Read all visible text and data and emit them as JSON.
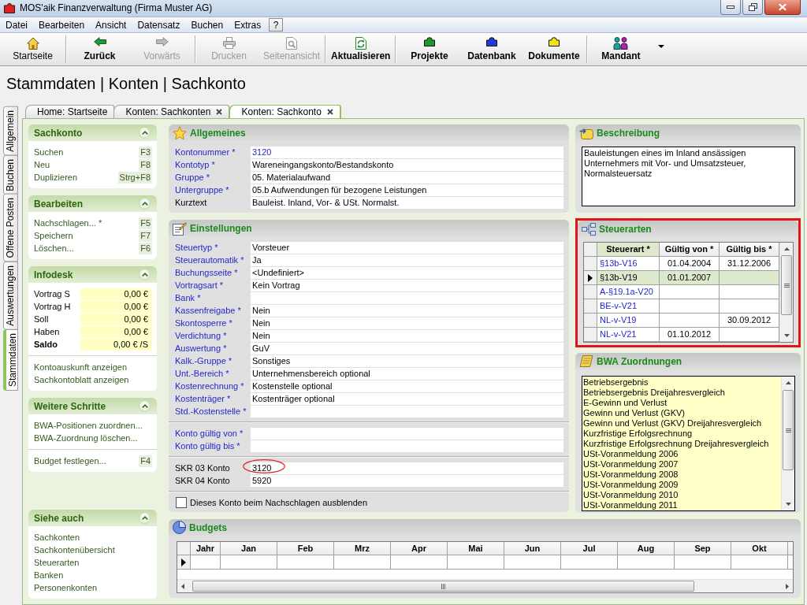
{
  "window": {
    "title": "MOS'aik Finanzverwaltung (Firma Muster AG)"
  },
  "menu": {
    "items": [
      "Datei",
      "Bearbeiten",
      "Ansicht",
      "Datensatz",
      "Buchen",
      "Extras"
    ],
    "help": "?"
  },
  "toolbar": [
    {
      "buttons": [
        {
          "label": "Startseite",
          "bold": false,
          "disabled": false
        }
      ]
    },
    {
      "buttons": [
        {
          "label": "Zurück",
          "bold": true,
          "disabled": false
        },
        {
          "label": "Vorwärts",
          "bold": false,
          "disabled": true
        }
      ]
    },
    {
      "buttons": [
        {
          "label": "Drucken",
          "bold": false,
          "disabled": true
        },
        {
          "label": "Seitenansicht",
          "bold": false,
          "disabled": true
        }
      ]
    },
    {
      "buttons": [
        {
          "label": "Aktualisieren",
          "bold": true,
          "disabled": false
        }
      ]
    },
    {
      "buttons": [
        {
          "label": "Projekte",
          "bold": true,
          "disabled": false
        },
        {
          "label": "Datenbank",
          "bold": true,
          "disabled": false
        },
        {
          "label": "Dokumente",
          "bold": true,
          "disabled": false
        }
      ]
    },
    {
      "buttons": [
        {
          "label": "Mandant",
          "bold": true,
          "disabled": false
        }
      ]
    }
  ],
  "breadcrumb": "Stammdaten | Konten | Sachkonto",
  "vertical_tabs": [
    {
      "label": "Allgemein",
      "selected": false
    },
    {
      "label": "Buchen",
      "selected": false
    },
    {
      "label": "Offene Posten",
      "selected": false
    },
    {
      "label": "Auswertungen",
      "selected": false
    },
    {
      "label": "Stammdaten",
      "selected": true
    }
  ],
  "doc_tabs": [
    {
      "label": "Home: Startseite",
      "selected": false,
      "closable": false
    },
    {
      "label": "Konten: Sachkonten",
      "selected": false,
      "closable": true
    },
    {
      "label": "Konten: Sachkonto",
      "selected": true,
      "closable": true
    }
  ],
  "task_pane": [
    {
      "title": "Sachkonto",
      "expanded": true,
      "sections": [
        {
          "kind": "links",
          "items": [
            {
              "label": "Suchen",
              "shortcut": "F3"
            },
            {
              "label": "Neu",
              "shortcut": "F8"
            },
            {
              "label": "Duplizieren",
              "shortcut": "Strg+F8"
            }
          ]
        }
      ]
    },
    {
      "title": "Bearbeiten",
      "expanded": true,
      "sections": [
        {
          "kind": "links",
          "items": [
            {
              "label": "Nachschlagen... *",
              "shortcut": "F5"
            },
            {
              "label": "Speichern",
              "shortcut": "F7"
            },
            {
              "label": "Löschen...",
              "shortcut": "F6"
            }
          ]
        }
      ]
    },
    {
      "title": "Infodesk",
      "expanded": true,
      "sections": [
        {
          "kind": "values",
          "items": [
            {
              "label": "Vortrag S",
              "value": "0,00 €",
              "bold": false
            },
            {
              "label": "Vortrag H",
              "value": "0,00 €",
              "bold": false
            },
            {
              "label": "Soll",
              "value": "0,00 €",
              "bold": false
            },
            {
              "label": "Haben",
              "value": "0,00 €",
              "bold": false
            },
            {
              "label": "Saldo",
              "value": "0,00 € /S",
              "bold": true
            }
          ]
        },
        {
          "kind": "links",
          "items": [
            {
              "label": "Kontoauskunft anzeigen"
            },
            {
              "label": "Sachkontoblatt anzeigen"
            }
          ]
        }
      ]
    },
    {
      "title": "Weitere Schritte",
      "expanded": true,
      "sections": [
        {
          "kind": "links",
          "items": [
            {
              "label": "BWA-Positionen zuordnen..."
            },
            {
              "label": "BWA-Zuordnung löschen..."
            }
          ]
        },
        {
          "kind": "links",
          "items": [
            {
              "label": "Budget festlegen...",
              "shortcut": "F4"
            }
          ]
        }
      ]
    },
    {
      "title": "Siehe auch",
      "expanded": true,
      "sections": [
        {
          "kind": "links",
          "items": [
            {
              "label": "Sachkonten"
            },
            {
              "label": "Sachkontenübersicht"
            },
            {
              "label": "Steuerarten"
            },
            {
              "label": "Banken"
            },
            {
              "label": "Personenkonten"
            }
          ]
        }
      ]
    }
  ],
  "general": {
    "title": "Allgemeines",
    "fields": [
      {
        "label": "Kontonummer *",
        "value": "3120",
        "link": true,
        "value_link": true
      },
      {
        "label": "Kontotyp *",
        "value": "Wareneingangskonto/Bestandskonto",
        "link": true,
        "value_link": false
      },
      {
        "label": "Gruppe *",
        "value": "05. Materialaufwand",
        "link": true,
        "value_link": false
      },
      {
        "label": "Untergruppe *",
        "value": "05.b Aufwendungen für bezogene Leistungen",
        "link": true,
        "value_link": false
      },
      {
        "label": "Kurztext",
        "value": "Bauleist. Inland, Vor- & USt. Normalst.",
        "link": false,
        "value_link": false
      }
    ]
  },
  "settings": {
    "title": "Einstellungen",
    "groups": [
      {
        "fields": [
          {
            "label": "Steuertyp *",
            "value": "Vorsteuer",
            "link": true
          },
          {
            "label": "Steuerautomatik *",
            "value": "Ja",
            "link": true
          },
          {
            "label": "Buchungsseite *",
            "value": "<Undefiniert>",
            "link": true
          },
          {
            "label": "Vortragsart *",
            "value": "Kein Vortrag",
            "link": true
          },
          {
            "label": "Bank *",
            "link": true
          },
          {
            "label": "Kassenfreigabe *",
            "value": "Nein",
            "link": true
          },
          {
            "label": "Skontosperre *",
            "value": "Nein",
            "link": true
          },
          {
            "label": "Verdichtung *",
            "value": "Nein",
            "link": true
          },
          {
            "label": "Auswertung *",
            "value": "GuV",
            "link": true
          },
          {
            "label": "Kalk.-Gruppe *",
            "value": "Sonstiges",
            "link": true
          },
          {
            "label": "Unt.-Bereich *",
            "value": "Unternehmensbereich optional",
            "link": true
          },
          {
            "label": "Kostenrechnung *",
            "value": "Kostenstelle optional",
            "link": true
          },
          {
            "label": "Kostenträger *",
            "value": "Kostenträger optional",
            "link": true
          },
          {
            "label": "Std.-Kostenstelle *",
            "link": true
          }
        ]
      },
      {
        "fields": [
          {
            "label": "Konto gültig von *",
            "link": true
          },
          {
            "label": "Konto gültig bis *",
            "link": true
          }
        ]
      },
      {
        "fields": [
          {
            "label": "SKR 03 Konto",
            "value": "3120",
            "link": false,
            "circled": true
          },
          {
            "label": "SKR 04 Konto",
            "value": "5920",
            "link": false,
            "circled": false
          }
        ]
      }
    ],
    "checkbox": {
      "label": "Dieses Konto beim Nachschlagen ausblenden",
      "checked": false
    }
  },
  "description": {
    "title": "Beschreibung",
    "text": "Bauleistungen eines im Inland ansässigen Unternehmers mit Vor- und Umsatzsteuer, Normalsteuersatz"
  },
  "tax_types": {
    "title": "Steuerarten",
    "highlighted": true,
    "columns": [
      {
        "label": "Steuerart *",
        "selected": true
      },
      {
        "label": "Gültig von *",
        "selected": false
      },
      {
        "label": "Gültig bis *",
        "selected": false
      }
    ],
    "rows": [
      {
        "steuerart": "§13b-V16",
        "gueltig_von": "01.04.2004",
        "gueltig_bis": "31.12.2006",
        "selected": false
      },
      {
        "steuerart": "§13b-V19",
        "gueltig_von": "01.01.2007",
        "selected": true
      },
      {
        "steuerart": "A-§19.1a-V20",
        "selected": false
      },
      {
        "steuerart": "BE-v-V21",
        "selected": false
      },
      {
        "steuerart": "NL-v-V19",
        "gueltig_bis": "30.09.2012",
        "selected": false
      },
      {
        "steuerart": "NL-v-V21",
        "gueltig_von": "01.10.2012",
        "selected": false
      }
    ]
  },
  "bwa": {
    "title": "BWA Zuordnungen",
    "items": [
      "Betriebsergebnis",
      "Betriebsergebnis Dreijahresvergleich",
      "E-Gewinn und Verlust",
      "Gewinn und Verlust (GKV)",
      "Gewinn und Verlust (GKV) Dreijahresvergleich",
      "Kurzfristige Erfolgsrechnung",
      "Kurzfristige Erfolgsrechnung Dreijahresvergleich",
      "USt-Voranmeldung 2006",
      "USt-Voranmeldung 2007",
      "USt-Voranmeldung 2008",
      "USt-Voranmeldung 2009",
      "USt-Voranmeldung 2010",
      "USt-Voranmeldung 2011"
    ]
  },
  "budgets": {
    "title": "Budgets",
    "columns": [
      "Jahr",
      "Jan",
      "Feb",
      "Mrz",
      "Apr",
      "Mai",
      "Jun",
      "Jul",
      "Aug",
      "Sep",
      "Okt"
    ],
    "rows": [
      {
        "selected": true
      }
    ]
  }
}
